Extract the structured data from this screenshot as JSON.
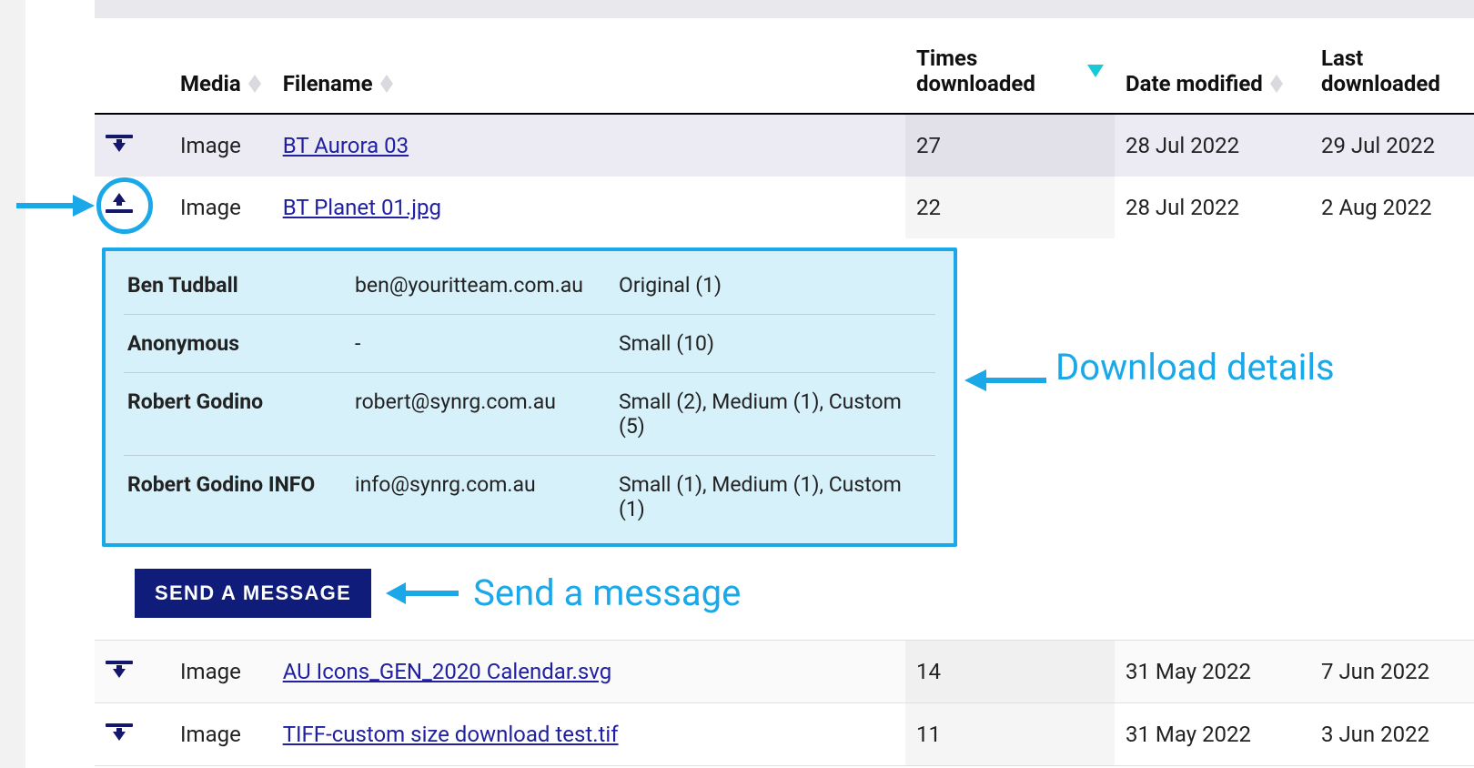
{
  "columns": {
    "media": "Media",
    "filename": "Filename",
    "times": "Times downloaded",
    "date_modified": "Date modified",
    "last_downloaded": "Last downloaded"
  },
  "rows": [
    {
      "media": "Image",
      "filename": "BT Aurora 03",
      "times": "27",
      "date_modified": "28 Jul 2022",
      "last_downloaded": "29 Jul 2022",
      "expanded": false
    },
    {
      "media": "Image",
      "filename": "BT Planet 01.jpg",
      "times": "22",
      "date_modified": "28 Jul 2022",
      "last_downloaded": "2 Aug 2022",
      "expanded": true
    },
    {
      "media": "Image",
      "filename": "AU Icons_GEN_2020 Calendar.svg",
      "times": "14",
      "date_modified": "31 May 2022",
      "last_downloaded": "7 Jun 2022",
      "expanded": false
    },
    {
      "media": "Image",
      "filename": "TIFF-custom size download test.tif",
      "times": "11",
      "date_modified": "31 May 2022",
      "last_downloaded": "3 Jun 2022",
      "expanded": false
    }
  ],
  "details": [
    {
      "name": "Ben Tudball",
      "email": "ben@youritteam.com.au",
      "sizes": "Original (1)"
    },
    {
      "name": "Anonymous",
      "email": "-",
      "sizes": "Small (10)"
    },
    {
      "name": "Robert Godino",
      "email": "robert@synrg.com.au",
      "sizes": "Small (2), Medium (1), Custom (5)"
    },
    {
      "name": "Robert Godino INFO",
      "email": "info@synrg.com.au",
      "sizes": "Small (1), Medium (1), Custom (1)"
    }
  ],
  "send_button": "SEND A MESSAGE",
  "annotations": {
    "download_details": "Download details",
    "send_a_message": "Send a message"
  }
}
